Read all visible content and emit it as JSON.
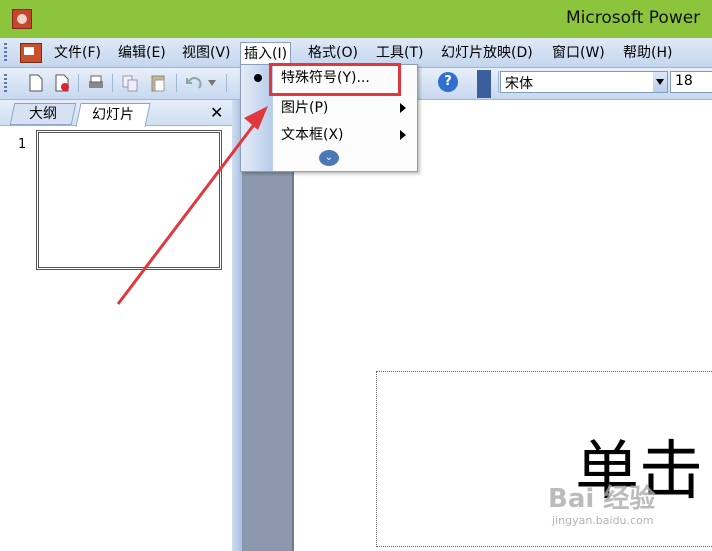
{
  "window": {
    "title": "Microsoft Power"
  },
  "menubar": {
    "items": [
      "文件(F)",
      "编辑(E)",
      "视图(V)",
      "插入(I)",
      "格式(O)",
      "工具(T)",
      "幻灯片放映(D)",
      "窗口(W)",
      "帮助(H)"
    ],
    "active": "插入(I)"
  },
  "toolbar": {
    "font_name": "宋体",
    "font_size": "18",
    "help_icon": "question-icon"
  },
  "insert_menu": {
    "items": [
      {
        "label": "特殊符号(Y)...",
        "has_submenu": false,
        "highlighted": true
      },
      {
        "label": "图片(P)",
        "has_submenu": true
      },
      {
        "label": "文本框(X)",
        "has_submenu": true
      }
    ],
    "expand_icon": "double-chevron-down-icon"
  },
  "left_pane": {
    "tabs": [
      "大纲",
      "幻灯片"
    ],
    "active_tab": "幻灯片",
    "close_label": "✕",
    "slide_number": "1"
  },
  "slide": {
    "title_placeholder_text": "单击"
  },
  "watermark": {
    "text": "Bai 经验",
    "sub": "jingyan.baidu.com"
  },
  "colors": {
    "titlebar": "#8cc43c",
    "highlight": "#e0383d",
    "workarea": "#8c99ad"
  }
}
